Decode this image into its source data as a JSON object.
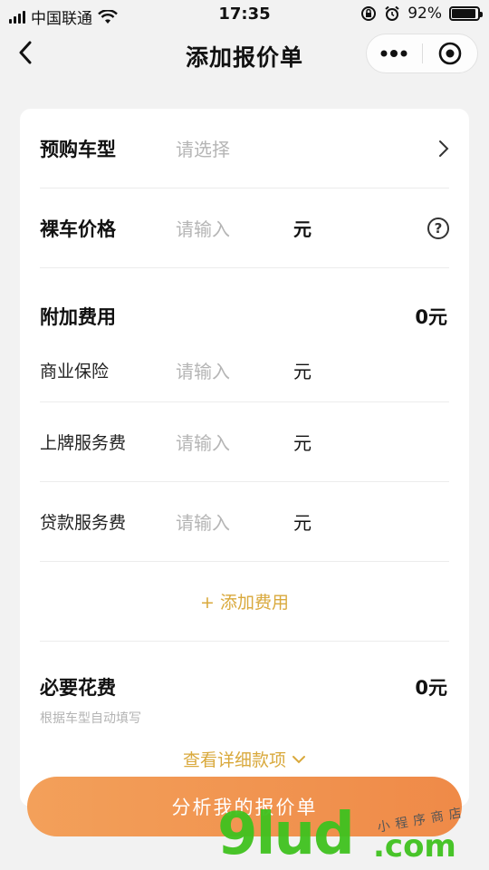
{
  "status_bar": {
    "carrier": "中国联通",
    "time": "17:35",
    "battery_percent": "92%",
    "battery_level": 0.92
  },
  "nav": {
    "title": "添加报价单",
    "back_icon": "chevron-left-icon",
    "more_icon": "more-dots-icon",
    "close_icon": "target-circle-icon"
  },
  "form": {
    "car_model": {
      "label": "预购车型",
      "placeholder": "请选择"
    },
    "bare_price": {
      "label": "裸车价格",
      "placeholder": "请输入",
      "unit": "元"
    },
    "extra_fees": {
      "label": "附加费用",
      "total": "0元",
      "items": [
        {
          "label": "商业保险",
          "placeholder": "请输入",
          "unit": "元"
        },
        {
          "label": "上牌服务费",
          "placeholder": "请输入",
          "unit": "元"
        },
        {
          "label": "贷款服务费",
          "placeholder": "请输入",
          "unit": "元"
        }
      ],
      "add_label": "+ 添加费用"
    },
    "required_costs": {
      "label": "必要花费",
      "total": "0元",
      "hint": "根据车型自动填写",
      "detail_link": "查看详细款项"
    }
  },
  "action": {
    "analyze_label": "分析我的报价单"
  },
  "watermark": {
    "big": "9lud",
    "com": ".com",
    "small": "小程序商店"
  },
  "colors": {
    "accent": "#d9a93c",
    "button_start": "#f3a05a",
    "button_end": "#ef8a48"
  }
}
